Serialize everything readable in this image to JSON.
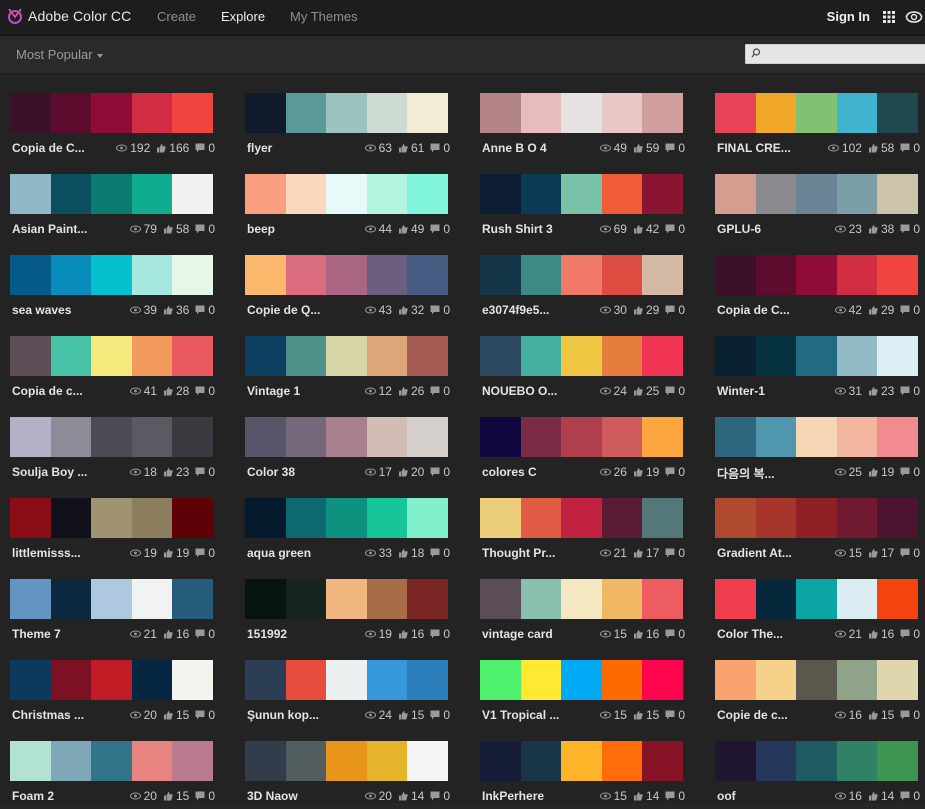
{
  "app": {
    "title": "Adobe Color CC"
  },
  "nav": [
    {
      "label": "Create",
      "active": false
    },
    {
      "label": "Explore",
      "active": true
    },
    {
      "label": "My Themes",
      "active": false
    }
  ],
  "header": {
    "signin_label": "Sign In"
  },
  "filter": {
    "sort_label": "Most Popular"
  },
  "search": {
    "value": "",
    "placeholder": ""
  },
  "icons": {
    "logo": "adobe-color-logo-icon",
    "apps": "apps-grid-icon",
    "cc": "creative-cloud-icon",
    "search": "search-icon",
    "views": "eye-icon",
    "likes": "thumbs-up-icon",
    "comments": "comment-icon"
  },
  "themes": [
    {
      "name": "Copia de C...",
      "views": "192",
      "likes": "166",
      "comments": "0",
      "colors": [
        "#3b1028",
        "#5d0c2e",
        "#8e0c35",
        "#d02d42",
        "#ef4440"
      ]
    },
    {
      "name": "flyer",
      "views": "63",
      "likes": "61",
      "comments": "0",
      "colors": [
        "#0f1b2b",
        "#5b9999",
        "#9bc4c0",
        "#cddbd2",
        "#f3ecd5"
      ]
    },
    {
      "name": "Anne B O 4",
      "views": "49",
      "likes": "59",
      "comments": "0",
      "colors": [
        "#b38585",
        "#e8bcbb",
        "#e7e2e2",
        "#e8c7c7",
        "#d1a09e"
      ]
    },
    {
      "name": "FINAL CRE...",
      "views": "102",
      "likes": "58",
      "comments": "0",
      "colors": [
        "#e84358",
        "#f1a72a",
        "#80c272",
        "#40b3cf",
        "#1e4a4e"
      ]
    },
    {
      "name": "Asian Paint...",
      "views": "79",
      "likes": "58",
      "comments": "0",
      "colors": [
        "#8fb8c9",
        "#0a4e5f",
        "#0b7b71",
        "#10ac8e",
        "#f3f1ef"
      ]
    },
    {
      "name": "beep",
      "views": "44",
      "likes": "49",
      "comments": "0",
      "colors": [
        "#f99e7f",
        "#fcd7c0",
        "#e7f9f9",
        "#b4f5df",
        "#80f3dc"
      ]
    },
    {
      "name": "Rush Shirt 3",
      "views": "69",
      "likes": "42",
      "comments": "0",
      "colors": [
        "#0b1c33",
        "#0a3b55",
        "#79c1a7",
        "#f25b38",
        "#8a1533"
      ]
    },
    {
      "name": "GPLU-6",
      "views": "23",
      "likes": "38",
      "comments": "0",
      "colors": [
        "#d39d90",
        "#8b8a8f",
        "#6a8495",
        "#7c9ea6",
        "#cbc4ab"
      ]
    },
    {
      "name": "sea waves",
      "views": "39",
      "likes": "36",
      "comments": "0",
      "colors": [
        "#045a88",
        "#088cbc",
        "#05c1d0",
        "#a6e7e0",
        "#e4f7e9"
      ]
    },
    {
      "name": "Copie de Q...",
      "views": "43",
      "likes": "32",
      "comments": "0",
      "colors": [
        "#fbb76c",
        "#da6c7d",
        "#a96581",
        "#6c5e80",
        "#465b82"
      ]
    },
    {
      "name": "e3074f9e5...",
      "views": "30",
      "likes": "29",
      "comments": "0",
      "colors": [
        "#153548",
        "#3d8a84",
        "#f0796a",
        "#dd4d41",
        "#d4baa4"
      ]
    },
    {
      "name": "Copia de C...",
      "views": "42",
      "likes": "29",
      "comments": "0",
      "colors": [
        "#3b1028",
        "#5d0c2e",
        "#8e0c35",
        "#d02d42",
        "#ef4440"
      ]
    },
    {
      "name": "Copia de c...",
      "views": "41",
      "likes": "28",
      "comments": "0",
      "colors": [
        "#5e4e58",
        "#47c2a6",
        "#f5e87c",
        "#f49a5c",
        "#ea5860"
      ]
    },
    {
      "name": "Vintage 1",
      "views": "12",
      "likes": "26",
      "comments": "0",
      "colors": [
        "#0d4060",
        "#4d918b",
        "#d8d6a8",
        "#dda67a",
        "#a65c54"
      ]
    },
    {
      "name": "NOUEBO O...",
      "views": "24",
      "likes": "25",
      "comments": "0",
      "colors": [
        "#2c4961",
        "#44b1a0",
        "#f0c742",
        "#e67d3c",
        "#f13454"
      ]
    },
    {
      "name": "Winter-1",
      "views": "31",
      "likes": "23",
      "comments": "0",
      "colors": [
        "#082030",
        "#06313f",
        "#226a80",
        "#92b9c6",
        "#dceff4"
      ]
    },
    {
      "name": "Soulja Boy ...",
      "views": "18",
      "likes": "23",
      "comments": "0",
      "colors": [
        "#b3b1c6",
        "#8c8b98",
        "#4d4c55",
        "#5b5a63",
        "#3b3a40"
      ]
    },
    {
      "name": "Color 38",
      "views": "17",
      "likes": "20",
      "comments": "0",
      "colors": [
        "#585469",
        "#76687c",
        "#a87f8c",
        "#d2bdb4",
        "#d6d0cd"
      ]
    },
    {
      "name": "colores C",
      "views": "26",
      "likes": "19",
      "comments": "0",
      "colors": [
        "#10073f",
        "#7a2b46",
        "#b03f4d",
        "#ce5a5d",
        "#fca63e"
      ]
    },
    {
      "name": "다음의 복...",
      "views": "25",
      "likes": "19",
      "comments": "0",
      "colors": [
        "#2d677e",
        "#5097ad",
        "#f5d6b6",
        "#f2b59f",
        "#f28b8f"
      ]
    },
    {
      "name": "littlemisss...",
      "views": "19",
      "likes": "19",
      "comments": "0",
      "colors": [
        "#8a0c14",
        "#10101a",
        "#a09370",
        "#8b7d5e",
        "#5f0208"
      ]
    },
    {
      "name": "aqua green",
      "views": "33",
      "likes": "18",
      "comments": "0",
      "colors": [
        "#051a2c",
        "#0c6871",
        "#0e927f",
        "#18c59a",
        "#80f0cd"
      ]
    },
    {
      "name": "Thought Pr...",
      "views": "21",
      "likes": "17",
      "comments": "0",
      "colors": [
        "#ebcd7a",
        "#e05c45",
        "#c02240",
        "#5a1c34",
        "#547779"
      ]
    },
    {
      "name": "Gradient At...",
      "views": "15",
      "likes": "17",
      "comments": "0",
      "colors": [
        "#b04a2e",
        "#a8352b",
        "#8e2026",
        "#6f1a30",
        "#4d1430"
      ]
    },
    {
      "name": "Theme 7",
      "views": "21",
      "likes": "16",
      "comments": "0",
      "colors": [
        "#6494c0",
        "#0b2841",
        "#adc8e0",
        "#f1f2f2",
        "#245c7a"
      ]
    },
    {
      "name": "151992",
      "views": "19",
      "likes": "16",
      "comments": "0",
      "colors": [
        "#071510",
        "#16251e",
        "#f2b781",
        "#a96c48",
        "#7a2424"
      ]
    },
    {
      "name": "vintage card",
      "views": "15",
      "likes": "16",
      "comments": "0",
      "colors": [
        "#5b4c55",
        "#8bc0b0",
        "#f3e8c1",
        "#f2b763",
        "#ec5c60"
      ]
    },
    {
      "name": "Color The...",
      "views": "21",
      "likes": "16",
      "comments": "0",
      "colors": [
        "#f03e4e",
        "#06283a",
        "#0aa5a4",
        "#dbedf2",
        "#f2440c"
      ]
    },
    {
      "name": "Christmas ...",
      "views": "20",
      "likes": "15",
      "comments": "0",
      "colors": [
        "#0c3a5e",
        "#7c1123",
        "#c31b25",
        "#072642",
        "#f2f4ed"
      ]
    },
    {
      "name": "Şunun kop...",
      "views": "24",
      "likes": "15",
      "comments": "0",
      "colors": [
        "#2c3e54",
        "#e74c3c",
        "#ecf0f1",
        "#3498db",
        "#2a7fbb"
      ]
    },
    {
      "name": "V1 Tropical ...",
      "views": "15",
      "likes": "15",
      "comments": "0",
      "colors": [
        "#4ff06b",
        "#feea33",
        "#00a9f4",
        "#ff6a00",
        "#ff0550"
      ]
    },
    {
      "name": "Copie de c...",
      "views": "16",
      "likes": "15",
      "comments": "0",
      "colors": [
        "#f9a470",
        "#f6d18a",
        "#5c574d",
        "#8fa388",
        "#dfd5ae"
      ]
    },
    {
      "name": "Foam 2",
      "views": "20",
      "likes": "15",
      "comments": "0",
      "colors": [
        "#b2e2d4",
        "#7ea8b8",
        "#327488",
        "#e8847f",
        "#b97a8e"
      ]
    },
    {
      "name": "3D Naow",
      "views": "20",
      "likes": "14",
      "comments": "0",
      "colors": [
        "#323c4a",
        "#505c5e",
        "#e8951c",
        "#e6b42a",
        "#f5f5f5"
      ]
    },
    {
      "name": "InkPerhere",
      "views": "15",
      "likes": "14",
      "comments": "0",
      "colors": [
        "#151c38",
        "#183647",
        "#feb429",
        "#ff6c0a",
        "#861426"
      ]
    },
    {
      "name": "oof",
      "views": "16",
      "likes": "14",
      "comments": "0",
      "colors": [
        "#201630",
        "#24375a",
        "#1f5b62",
        "#2f8266",
        "#3d9552"
      ]
    }
  ]
}
